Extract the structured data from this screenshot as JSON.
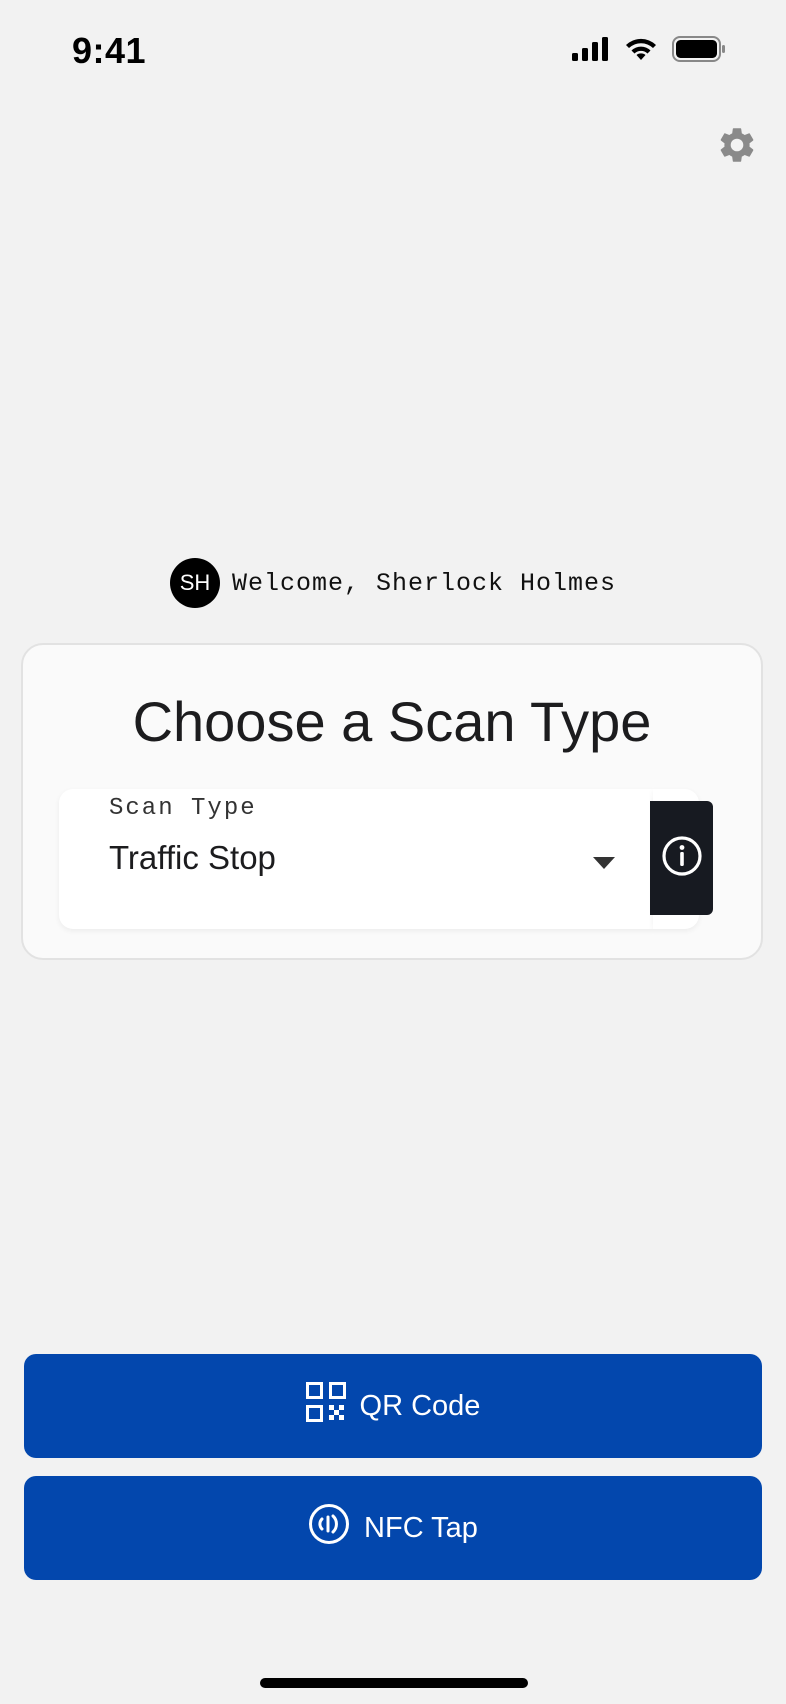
{
  "status_bar": {
    "time": "9:41",
    "icons": [
      "cellular-signal-icon",
      "wifi-icon",
      "battery-icon"
    ]
  },
  "settings": {
    "icon": "gear-icon"
  },
  "welcome": {
    "avatar_initials": "SH",
    "text": "Welcome, Sherlock Holmes"
  },
  "card": {
    "title": "Choose a Scan Type",
    "select": {
      "label": "Scan Type",
      "value": "Traffic Stop"
    },
    "info_icon": "info-icon"
  },
  "actions": {
    "qr": {
      "label": "QR Code",
      "icon": "qr-code-icon"
    },
    "nfc": {
      "label": "NFC Tap",
      "icon": "nfc-icon"
    }
  },
  "colors": {
    "background": "#f2f2f2",
    "primary_button": "#0347ad",
    "info_button": "#171a21",
    "avatar": "#000000"
  }
}
